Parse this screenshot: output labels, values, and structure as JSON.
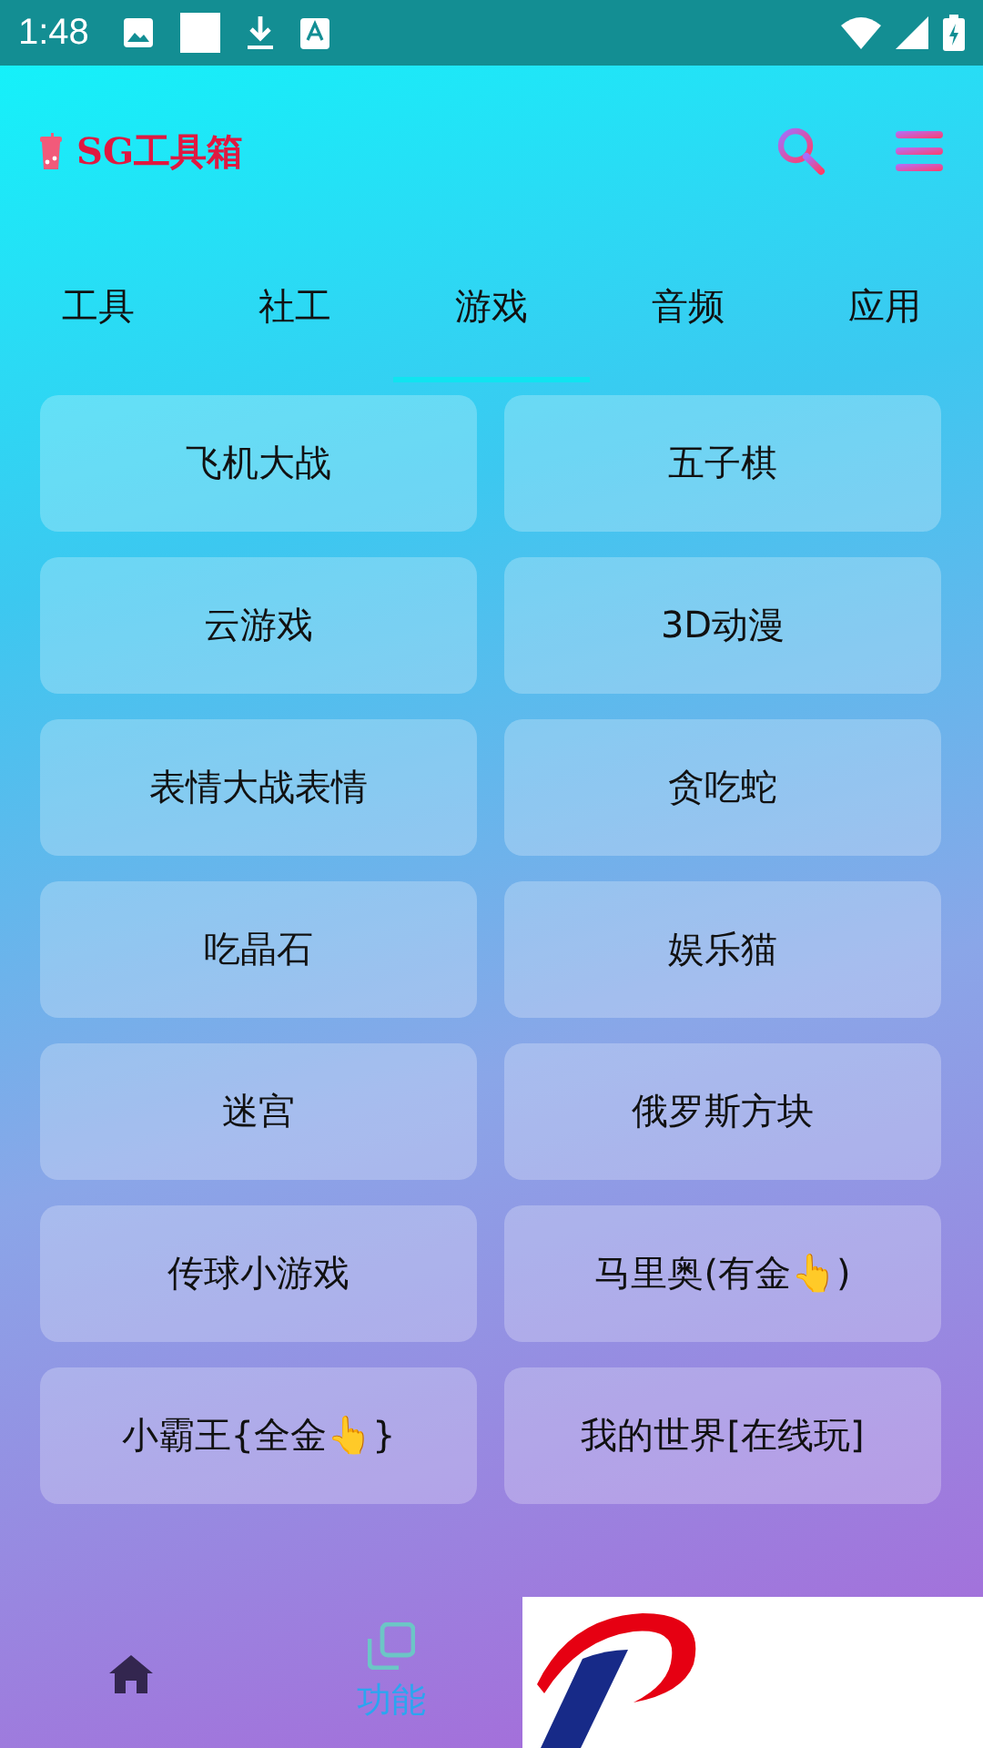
{
  "status_bar": {
    "time": "1:48"
  },
  "app_bar": {
    "title": "SG工具箱"
  },
  "tabs": [
    {
      "label": "工具",
      "selected": false
    },
    {
      "label": "社工",
      "selected": false
    },
    {
      "label": "游戏",
      "selected": true
    },
    {
      "label": "音频",
      "selected": false
    },
    {
      "label": "应用",
      "selected": false
    }
  ],
  "buttons": [
    "飞机大战",
    "五子棋",
    "云游戏",
    "3D动漫",
    "表情大战表情",
    "贪吃蛇",
    "吃晶石",
    "娱乐猫",
    "迷宫",
    "俄罗斯方块",
    "传球小游戏",
    "马里奥(有金👆)",
    "小霸王{全金👆}",
    "我的世界[在线玩]"
  ],
  "bottom_nav": [
    {
      "kind": "home",
      "selected": false
    },
    {
      "kind": "features",
      "label": "功能",
      "selected": true
    }
  ]
}
